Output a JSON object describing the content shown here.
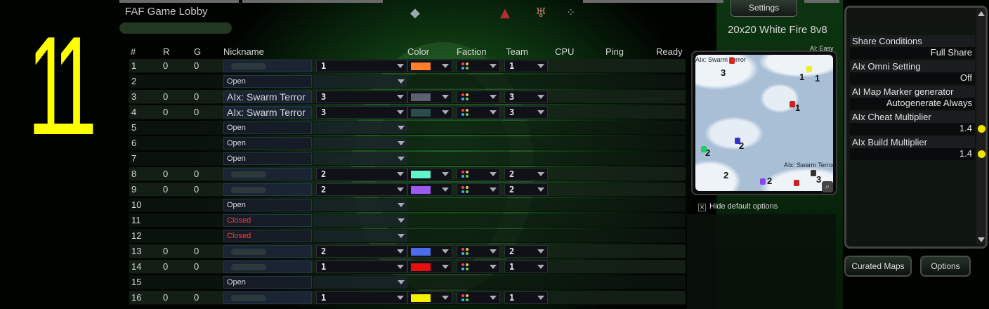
{
  "window_title": "FAF Game Lobby",
  "player_slot_overlay": "11",
  "settings_button": "Settings",
  "map_title": "20x20 White Fire 8v8",
  "columns": {
    "num": "#",
    "rating": "R",
    "games": "G",
    "nickname": "Nickname",
    "color": "Color",
    "faction": "Faction",
    "team": "Team",
    "cpu": "CPU",
    "ping": "Ping",
    "ready": "Ready"
  },
  "slots": [
    {
      "num": "1",
      "rating": "0",
      "games": "0",
      "nickname": "",
      "state": "player",
      "team": "1",
      "color": "#ff7f2a",
      "team_display": "1"
    },
    {
      "num": "2",
      "rating": "",
      "games": "",
      "nickname": "Open",
      "state": "open"
    },
    {
      "num": "3",
      "rating": "0",
      "games": "0",
      "nickname": "AIx: Swarm Terror",
      "state": "ai",
      "team": "3",
      "color": "#5a6270",
      "team_display": "3"
    },
    {
      "num": "4",
      "rating": "0",
      "games": "0",
      "nickname": "AIx: Swarm Terror",
      "state": "ai",
      "team": "3",
      "color": "#2b4c4c",
      "team_display": "3"
    },
    {
      "num": "5",
      "rating": "",
      "games": "",
      "nickname": "Open",
      "state": "open"
    },
    {
      "num": "6",
      "rating": "",
      "games": "",
      "nickname": "Open",
      "state": "open"
    },
    {
      "num": "7",
      "rating": "",
      "games": "",
      "nickname": "Open",
      "state": "open"
    },
    {
      "num": "8",
      "rating": "0",
      "games": "0",
      "nickname": "",
      "state": "player",
      "team": "2",
      "color": "#5ff5c8",
      "team_display": "2"
    },
    {
      "num": "9",
      "rating": "0",
      "games": "0",
      "nickname": "",
      "state": "player",
      "team": "2",
      "color": "#9a5cf0",
      "team_display": "2"
    },
    {
      "num": "10",
      "rating": "",
      "games": "",
      "nickname": "Open",
      "state": "open"
    },
    {
      "num": "11",
      "rating": "",
      "games": "",
      "nickname": "Closed",
      "state": "closed"
    },
    {
      "num": "12",
      "rating": "",
      "games": "",
      "nickname": "Closed",
      "state": "closed"
    },
    {
      "num": "13",
      "rating": "0",
      "games": "0",
      "nickname": "",
      "state": "player",
      "team": "2",
      "color": "#4a6ee8",
      "team_display": "2"
    },
    {
      "num": "14",
      "rating": "0",
      "games": "0",
      "nickname": "",
      "state": "player",
      "team": "1",
      "color": "#e80f0f",
      "team_display": "1"
    },
    {
      "num": "15",
      "rating": "",
      "games": "",
      "nickname": "Open",
      "state": "open"
    },
    {
      "num": "16",
      "rating": "0",
      "games": "0",
      "nickname": "",
      "state": "player",
      "team": "1",
      "color": "#f5f000",
      "team_display": "1"
    }
  ],
  "map_preview": {
    "label_top_right": "AI: Easy",
    "label_top_left": "AIx: Swarm Terror",
    "label_bottom_right": "AIx: Swarm Terror",
    "spawn_numbers": [
      "3",
      "1",
      "1",
      "1",
      "2",
      "2",
      "2",
      "2",
      "3"
    ]
  },
  "hide_default_options": "Hide default options",
  "options": [
    {
      "label": "Share Conditions",
      "value": "Full Share",
      "modified": false
    },
    {
      "label": "AIx Omni Setting",
      "value": "Off",
      "modified": false
    },
    {
      "label": "AI Map Marker generator",
      "value": "Autogenerate Always",
      "modified": false
    },
    {
      "label": "AIx Cheat Multiplier",
      "value": "1.4",
      "modified": true
    },
    {
      "label": "AIx Build Multiplier",
      "value": "1.4",
      "modified": true
    }
  ],
  "buttons": {
    "curated_maps": "Curated Maps",
    "options": "Options"
  },
  "colors": {
    "overlay_number": "#ffff00",
    "closed_text": "#ff3b3b",
    "modified_dot": "#f2e400"
  },
  "faction_dot_colors": [
    "#e84a4a",
    "#f2c14a",
    "#4ab0e8",
    "#5ad05a"
  ]
}
